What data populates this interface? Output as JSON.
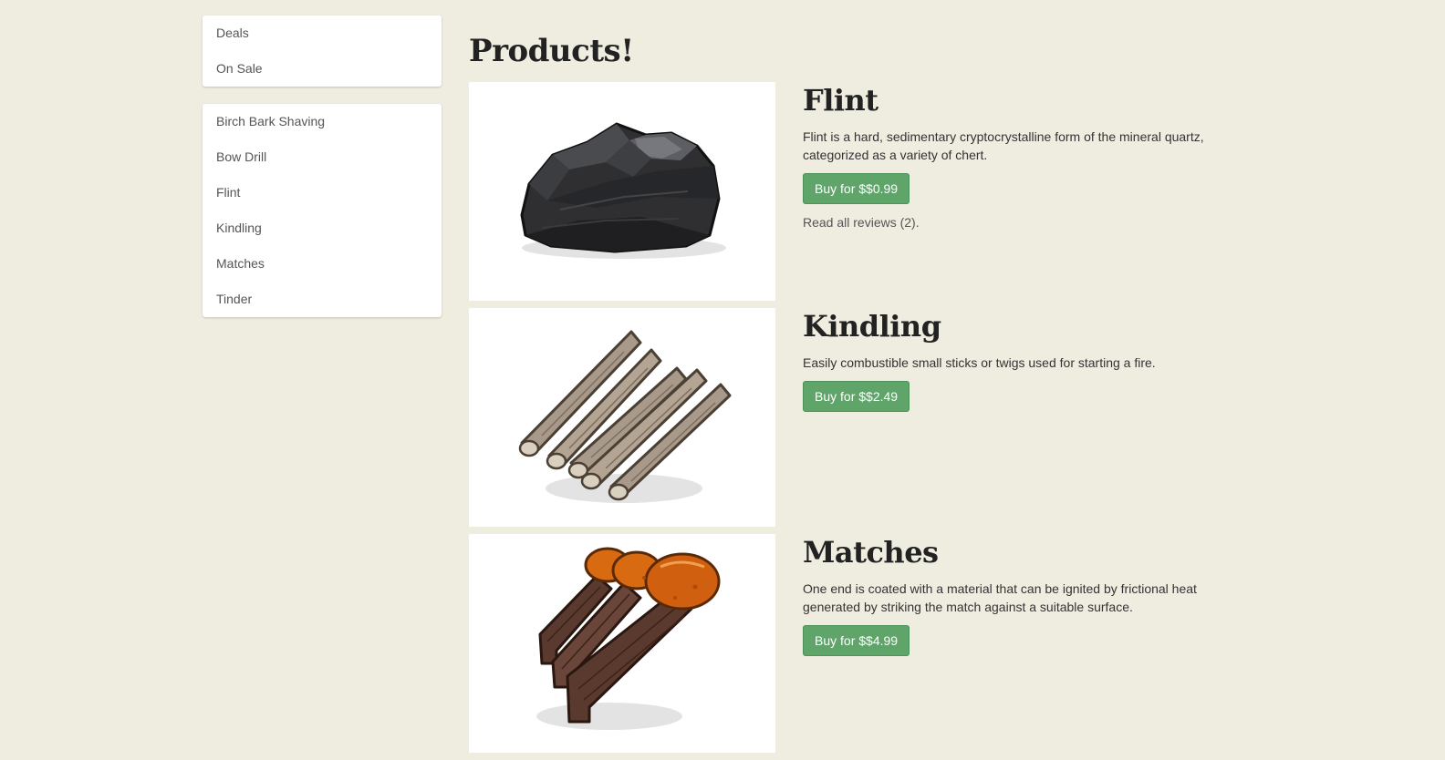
{
  "sidebar": {
    "top_items": [
      {
        "label": "Deals"
      },
      {
        "label": "On Sale"
      }
    ],
    "category_items": [
      {
        "label": "Birch Bark Shaving"
      },
      {
        "label": "Bow Drill"
      },
      {
        "label": "Flint"
      },
      {
        "label": "Kindling"
      },
      {
        "label": "Matches"
      },
      {
        "label": "Tinder"
      }
    ]
  },
  "main": {
    "title": "Products!"
  },
  "products": [
    {
      "name": "Flint",
      "description": "Flint is a hard, sedimentary cryptocrystalline form of the mineral quartz, categorized as a variety of chert.",
      "buy_label": "Buy for $$0.99",
      "reviews_label": "Read all reviews (2).",
      "image_icon": "flint-rock-icon"
    },
    {
      "name": "Kindling",
      "description": "Easily combustible small sticks or twigs used for starting a fire.",
      "buy_label": "Buy for $$2.49",
      "image_icon": "kindling-sticks-icon"
    },
    {
      "name": "Matches",
      "description": "One end is coated with a material that can be ignited by frictional heat generated by striking the match against a suitable surface.",
      "buy_label": "Buy for $$4.99",
      "image_icon": "matches-icon"
    }
  ],
  "colors": {
    "background": "#efece0",
    "button": "#5fa56a"
  }
}
